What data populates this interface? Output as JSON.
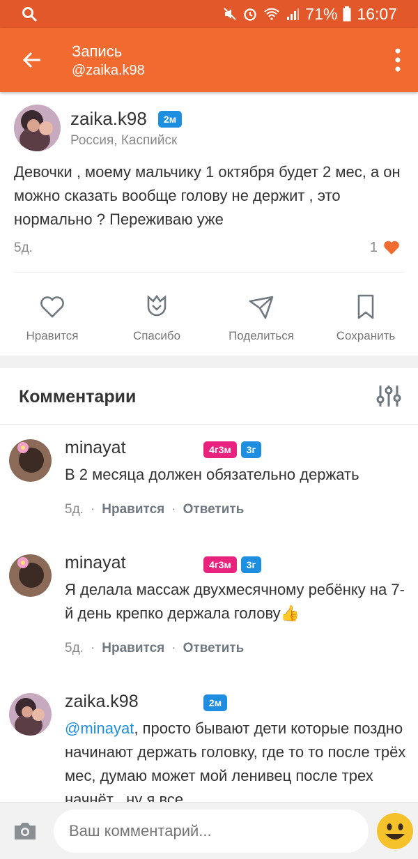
{
  "status_bar": {
    "battery": "71%",
    "time": "16:07"
  },
  "app_bar": {
    "title": "Запись",
    "subtitle": "@zaika.k98"
  },
  "post": {
    "author": "zaika.k98",
    "badge": "2м",
    "location": "Россия, Каспийск",
    "text": "Девочки , моему мальчику 1 октября будет 2 мес, а он можно сказать вообще голову не держит , это нормально ? Переживаю уже",
    "age": "5д.",
    "like_count": "1"
  },
  "actions": [
    {
      "label": "Нравится",
      "icon": "heart-outline-icon"
    },
    {
      "label": "Спасибо",
      "icon": "tulip-icon"
    },
    {
      "label": "Поделиться",
      "icon": "paper-plane-icon"
    },
    {
      "label": "Сохранить",
      "icon": "bookmark-icon"
    }
  ],
  "comments_section": {
    "title": "Комментарии",
    "items": [
      {
        "author": "minayat",
        "badges": [
          "4г3м",
          "3г"
        ],
        "text": "В 2 месяца должен обязательно держать",
        "age": "5д.",
        "like": "Нравится",
        "reply": "Ответить"
      },
      {
        "author": "minayat",
        "badges": [
          "4г3м",
          "3г"
        ],
        "text": "Я делала массаж двухмесячному ребёнку на 7-й день крепко держала голову👍",
        "age": "5д.",
        "like": "Нравится",
        "reply": "Ответить"
      },
      {
        "author": "zaika.k98",
        "badges": [
          "2м"
        ],
        "mention": "@minayat",
        "text": ", просто бывают дети которые поздно начинают держать головку, где то то после трёх мес, думаю может мой ленивец после трех начнёт , ну я все"
      }
    ]
  },
  "composer": {
    "placeholder": "Ваш комментарий..."
  },
  "colors": {
    "appbar": "#f16a30",
    "statusbar": "#e2582a",
    "badge_blue": "#1e8fe0",
    "badge_pink": "#e8237d",
    "heart": "#f16a30"
  }
}
